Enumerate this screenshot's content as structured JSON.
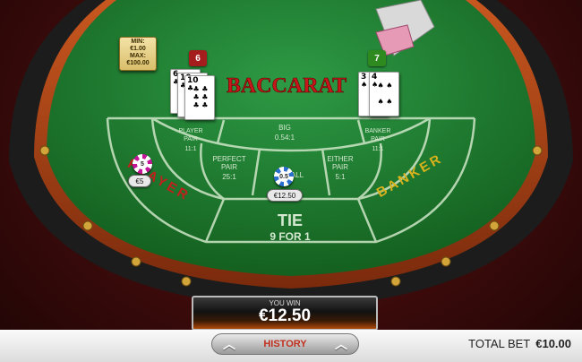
{
  "limits": {
    "min_label": "MIN:",
    "min_value": "€1.00",
    "max_label": "MAX:",
    "max_value": "€100.00"
  },
  "title": "BACCARAT",
  "player": {
    "score": "6",
    "label": "PLAYER",
    "cards": [
      {
        "rank": "6",
        "suit": "♣"
      },
      {
        "rank": "10",
        "suit": "♣"
      },
      {
        "rank": "10",
        "suit": "♣"
      }
    ]
  },
  "banker": {
    "score": "7",
    "label": "BANKER",
    "cards": [
      {
        "rank": "3",
        "suit": "♠"
      },
      {
        "rank": "4",
        "suit": "♠"
      }
    ]
  },
  "bet_areas": {
    "player_pair": {
      "name_line1": "PLAYER",
      "name_line2": "PAIR",
      "odds": "11:1"
    },
    "big": {
      "name": "BIG",
      "odds": "0.54:1"
    },
    "banker_pair": {
      "name_line1": "BANKER",
      "name_line2": "PAIR",
      "odds": "11:1"
    },
    "perfect_pair": {
      "name_line1": "PERFECT",
      "name_line2": "PAIR",
      "odds": "25:1"
    },
    "small": {
      "name": "SMALL"
    },
    "either_pair": {
      "name_line1": "EITHER",
      "name_line2": "PAIR",
      "odds": "5:1"
    },
    "tie": {
      "name": "TIE",
      "odds": "9 FOR 1"
    }
  },
  "chips": {
    "player": {
      "chip_value": "5",
      "bet_label": "€5"
    },
    "tie": {
      "chip_value": "0.5",
      "bet_label": "€12.50"
    }
  },
  "win": {
    "label": "YOU WIN",
    "amount": "€12.50"
  },
  "footer": {
    "history_label": "HISTORY",
    "total_bet_label": "TOTAL BET",
    "total_bet_value": "€10.00"
  },
  "colors": {
    "felt": "#1f7a32",
    "rail": "#2a2a2a",
    "player": "#c0201c",
    "banker": "#d8b21c",
    "win_glow": "#b04a0a"
  }
}
